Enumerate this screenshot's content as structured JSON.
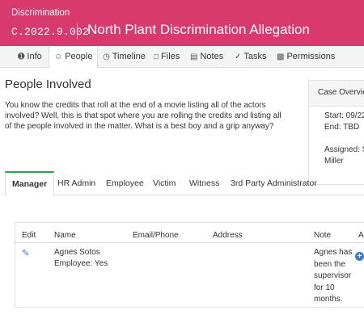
{
  "header": {
    "category": "Discrimination",
    "case_id": "C.2022.9.002",
    "title": "North Plant Discrimination Allegation"
  },
  "nav": {
    "tabs": [
      {
        "label": "Info",
        "icon": "info-circle-icon"
      },
      {
        "label": "People",
        "icon": "person-icon",
        "active": true
      },
      {
        "label": "Timeline",
        "icon": "clock-icon"
      },
      {
        "label": "Files",
        "icon": "file-icon"
      },
      {
        "label": "Notes",
        "icon": "notes-icon"
      },
      {
        "label": "Tasks",
        "icon": "checkmark-icon"
      },
      {
        "label": "Permissions",
        "icon": "lock-icon"
      }
    ]
  },
  "people": {
    "title": "People Involved",
    "intro": "You know the credits that roll at the end of a movie listing all of the actors involved? Well, this is that spot where you are rolling the credits and listing all of the people involved in the matter. What is a best boy and a grip anyway?"
  },
  "case_overview": {
    "title": "Case Overview",
    "start": "Start: 09/22",
    "end": "End: TBD",
    "assigned": "Assigned: S",
    "assigned_cont": "Miller"
  },
  "role_tabs": [
    "Manager",
    "HR Admin",
    "Employee",
    "Victim",
    "Witness",
    "3rd Party Administrator"
  ],
  "table": {
    "headers": [
      "Edit",
      "Name",
      "Email/Phone",
      "Address",
      "Note",
      "Ac"
    ],
    "rows": [
      {
        "name": "Agnes Sotos",
        "employee": "Employee: Yes",
        "email_phone": "",
        "address": "",
        "note_lines": [
          "Agnes has",
          "been the",
          "supervisor",
          "for 10",
          "months."
        ]
      }
    ]
  },
  "colors": {
    "header_bg": "#d83a6d",
    "active_tab_accent": "#2aa34a",
    "icon_blue": "#3b7cc4"
  }
}
